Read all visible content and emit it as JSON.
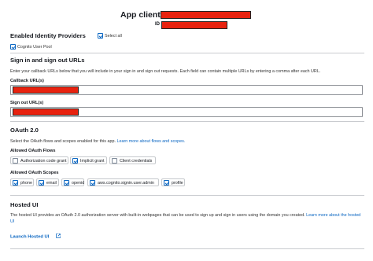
{
  "header": {
    "title": "App client",
    "id_label": "ID"
  },
  "identity_providers": {
    "heading": "Enabled Identity Providers",
    "select_all_label": "Select all",
    "select_all_checked": true,
    "cognito_label": "Cognito User Pool",
    "cognito_checked": true
  },
  "sign_urls": {
    "heading": "Sign in and sign out URLs",
    "description": "Enter your callback URLs below that you will include in your sign in and sign out requests. Each field can contain multiple URLs by entering a comma after each URL.",
    "callback_label": "Callback URL(s)",
    "signout_label": "Sign out URL(s)"
  },
  "oauth": {
    "heading": "OAuth 2.0",
    "description": "Select the OAuth flows and scopes enabled for this app.",
    "learn_more": "Learn more about flows and scopes.",
    "flows_label": "Allowed OAuth Flows",
    "flows": [
      {
        "label": "Authorization code grant",
        "checked": false
      },
      {
        "label": "Implicit grant",
        "checked": true
      },
      {
        "label": "Client credentials",
        "checked": false
      }
    ],
    "scopes_label": "Allowed OAuth Scopes",
    "scopes": [
      {
        "label": "phone",
        "checked": true
      },
      {
        "label": "email",
        "checked": true
      },
      {
        "label": "openid",
        "checked": true
      },
      {
        "label": "aws.cognito.signin.user.admin",
        "checked": true
      },
      {
        "label": "profile",
        "checked": true
      }
    ]
  },
  "hosted_ui": {
    "heading": "Hosted UI",
    "description": "The hosted UI provides an OAuth 2.0 authorization server with built-in webpages that can be used to sign up and sign in users using the domain you created.",
    "learn_more_1": "Learn more about the",
    "learn_more_2": "hosted UI",
    "launch_label": "Launch Hosted UI"
  },
  "colors": {
    "accent": "#0a66c2",
    "redaction": "#e8220f"
  }
}
